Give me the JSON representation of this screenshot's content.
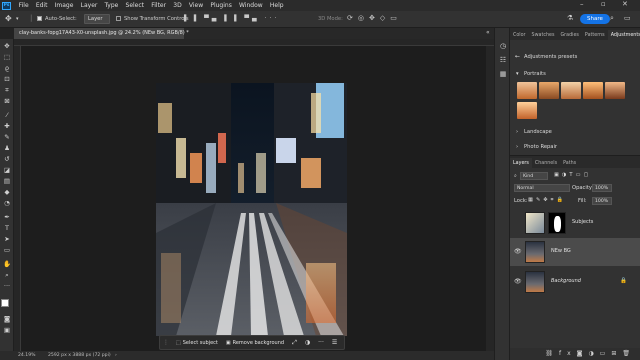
{
  "menu": {
    "app_logo": "Ps",
    "items": [
      "File",
      "Edit",
      "Image",
      "Layer",
      "Type",
      "Select",
      "Filter",
      "3D",
      "View",
      "Plugins",
      "Window",
      "Help"
    ]
  },
  "options_bar": {
    "auto_select_label": "Auto-Select:",
    "auto_select_value": "Layer",
    "show_transform_label": "Show Transform Controls",
    "mode_3d_label": "3D Mode:",
    "share_label": "Share"
  },
  "document": {
    "tab_title": "clay-banks-fopg17A43-X0-unsplash.jpg @ 24.2% (NEw BG, RGB/8) *",
    "zoom": "24.19%",
    "doc_info": "2592 px x 3888 px (72 ppi)"
  },
  "taskbar": {
    "select_subject": "Select subject",
    "remove_background": "Remove background"
  },
  "panels": {
    "top_tabs": [
      "Color",
      "Swatches",
      "Gradies",
      "Patterns",
      "Adjustments"
    ],
    "active_top_tab": "Adjustments",
    "adjustments_title": "Adjustments presets",
    "sections": [
      "Portraits",
      "Landscape",
      "Photo Repair"
    ],
    "layer_tabs": [
      "Layers",
      "Channels",
      "Paths"
    ],
    "filter_kind": "Kind",
    "blend_mode": "Normal",
    "opacity_label": "Opacity:",
    "opacity_value": "100%",
    "lock_label": "Lock:",
    "fill_label": "Fill:",
    "fill_value": "100%",
    "layers": [
      {
        "name": "Subjects",
        "selected": false
      },
      {
        "name": "NEw BG",
        "selected": true
      },
      {
        "name": "Background",
        "selected": false
      }
    ]
  },
  "colors": {
    "accent": "#1473e6",
    "ps_blue": "#31a8ff"
  }
}
